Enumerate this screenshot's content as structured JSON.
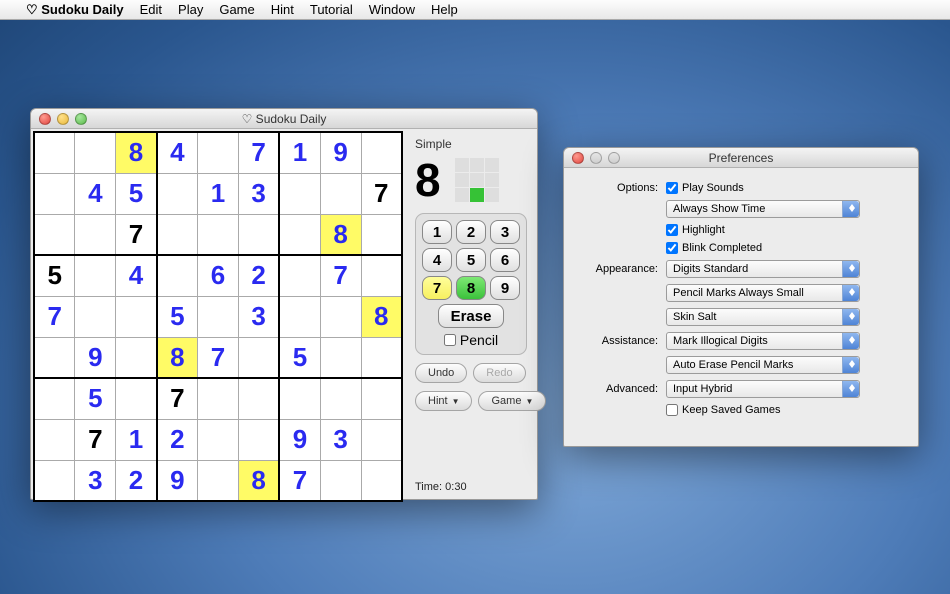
{
  "menubar": {
    "apple": "",
    "app": "♡ Sudoku Daily",
    "items": [
      "Edit",
      "Play",
      "Game",
      "Hint",
      "Tutorial",
      "Window",
      "Help"
    ]
  },
  "main": {
    "title": "♡ Sudoku Daily",
    "difficulty": "Simple",
    "selected_digit": "8",
    "grid": [
      [
        {
          "v": ""
        },
        {
          "v": ""
        },
        {
          "v": "8",
          "t": "u",
          "h": 1
        },
        {
          "v": "4",
          "t": "u"
        },
        {
          "v": ""
        },
        {
          "v": "7",
          "t": "u"
        },
        {
          "v": "1",
          "t": "u"
        },
        {
          "v": "9",
          "t": "u"
        },
        {
          "v": ""
        }
      ],
      [
        {
          "v": ""
        },
        {
          "v": "4",
          "t": "u"
        },
        {
          "v": "5",
          "t": "u"
        },
        {
          "v": ""
        },
        {
          "v": "1",
          "t": "u"
        },
        {
          "v": "3",
          "t": "u"
        },
        {
          "v": ""
        },
        {
          "v": ""
        },
        {
          "v": "7",
          "t": "g"
        }
      ],
      [
        {
          "v": ""
        },
        {
          "v": ""
        },
        {
          "v": "7",
          "t": "g"
        },
        {
          "v": ""
        },
        {
          "v": ""
        },
        {
          "v": ""
        },
        {
          "v": ""
        },
        {
          "v": "8",
          "t": "u",
          "h": 1
        },
        {
          "v": ""
        }
      ],
      [
        {
          "v": "5",
          "t": "g"
        },
        {
          "v": ""
        },
        {
          "v": "4",
          "t": "u"
        },
        {
          "v": ""
        },
        {
          "v": "6",
          "t": "u"
        },
        {
          "v": "2",
          "t": "u"
        },
        {
          "v": ""
        },
        {
          "v": "7",
          "t": "u"
        },
        {
          "v": ""
        }
      ],
      [
        {
          "v": "7",
          "t": "u"
        },
        {
          "v": ""
        },
        {
          "v": ""
        },
        {
          "v": "5",
          "t": "u"
        },
        {
          "v": ""
        },
        {
          "v": "3",
          "t": "u"
        },
        {
          "v": ""
        },
        {
          "v": ""
        },
        {
          "v": "8",
          "t": "u",
          "h": 1
        }
      ],
      [
        {
          "v": ""
        },
        {
          "v": "9",
          "t": "u"
        },
        {
          "v": ""
        },
        {
          "v": "8",
          "t": "u",
          "h": 1
        },
        {
          "v": "7",
          "t": "u"
        },
        {
          "v": ""
        },
        {
          "v": "5",
          "t": "u"
        },
        {
          "v": ""
        },
        {
          "v": ""
        }
      ],
      [
        {
          "v": ""
        },
        {
          "v": "5",
          "t": "u"
        },
        {
          "v": ""
        },
        {
          "v": "7",
          "t": "g"
        },
        {
          "v": ""
        },
        {
          "v": ""
        },
        {
          "v": ""
        },
        {
          "v": ""
        },
        {
          "v": ""
        }
      ],
      [
        {
          "v": ""
        },
        {
          "v": "7",
          "t": "g"
        },
        {
          "v": "1",
          "t": "u"
        },
        {
          "v": "2",
          "t": "u"
        },
        {
          "v": ""
        },
        {
          "v": ""
        },
        {
          "v": "9",
          "t": "u"
        },
        {
          "v": "3",
          "t": "u"
        },
        {
          "v": ""
        }
      ],
      [
        {
          "v": ""
        },
        {
          "v": "3",
          "t": "u"
        },
        {
          "v": "2",
          "t": "u"
        },
        {
          "v": "9",
          "t": "u"
        },
        {
          "v": ""
        },
        {
          "v": "8",
          "t": "u",
          "h": 1
        },
        {
          "v": "7",
          "t": "u"
        },
        {
          "v": ""
        },
        {
          "v": ""
        }
      ]
    ],
    "mini_on": 7,
    "keypad": {
      "keys": [
        "1",
        "2",
        "3",
        "4",
        "5",
        "6",
        "7",
        "8",
        "9"
      ],
      "hl_index": 6,
      "sel_index": 7,
      "erase": "Erase",
      "pencil": "Pencil",
      "pencil_checked": false
    },
    "buttons": {
      "undo": "Undo",
      "redo": "Redo",
      "hint": "Hint",
      "game": "Game"
    },
    "time_label": "Time: 0:30"
  },
  "prefs": {
    "title": "Preferences",
    "sections": {
      "options_label": "Options:",
      "appearance_label": "Appearance:",
      "assistance_label": "Assistance:",
      "advanced_label": "Advanced:"
    },
    "options": {
      "play_sounds": {
        "label": "Play Sounds",
        "checked": true
      },
      "time_mode": "Always Show Time",
      "highlight": {
        "label": "Highlight",
        "checked": true
      },
      "blink": {
        "label": "Blink Completed",
        "checked": true
      }
    },
    "appearance": {
      "digits": "Digits Standard",
      "pencil": "Pencil Marks Always Small",
      "skin": "Skin Salt"
    },
    "assistance": {
      "illogical": "Mark Illogical Digits",
      "autoerase": "Auto Erase Pencil Marks"
    },
    "advanced": {
      "input": "Input Hybrid",
      "keep_saved": {
        "label": "Keep Saved Games",
        "checked": false
      }
    }
  }
}
